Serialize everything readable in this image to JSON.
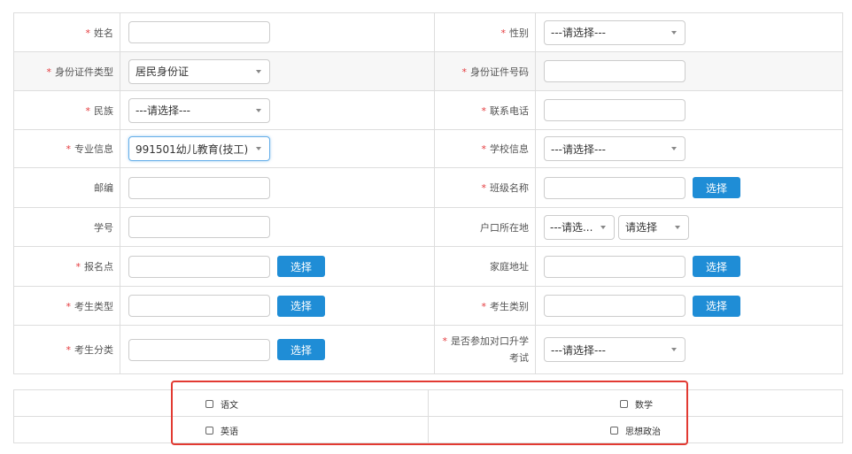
{
  "form": {
    "rows": [
      {
        "left_label": "姓名",
        "left_required": true,
        "left_value": "",
        "right_label": "性别",
        "right_required": true,
        "right_select": "---请选择---"
      },
      {
        "left_label": "身份证件类型",
        "left_required": true,
        "left_select": "居民身份证",
        "right_label": "身份证件号码",
        "right_required": true,
        "right_value": ""
      },
      {
        "left_label": "民族",
        "left_required": true,
        "left_select": "---请选择---",
        "right_label": "联系电话",
        "right_required": true,
        "right_value": ""
      },
      {
        "left_label": "专业信息",
        "left_required": true,
        "left_select": "991501幼儿教育(技工)",
        "right_label": "学校信息",
        "right_required": true,
        "right_select": "---请选择---"
      },
      {
        "left_label": "邮编",
        "left_required": false,
        "left_value": "",
        "right_label": "班级名称",
        "right_required": true,
        "right_value": "",
        "right_button": "选择"
      },
      {
        "left_label": "学号",
        "left_required": false,
        "left_value": "",
        "right_label": "户口所在地",
        "right_required": false,
        "right_select_1": "---请选...",
        "right_select_2": "请选择"
      },
      {
        "left_label": "报名点",
        "left_required": true,
        "left_value": "",
        "left_button": "选择",
        "right_label": "家庭地址",
        "right_required": false,
        "right_value": "",
        "right_button": "选择"
      },
      {
        "left_label": "考生类型",
        "left_required": true,
        "left_value": "",
        "left_button": "选择",
        "right_label": "考生类别",
        "right_required": true,
        "right_value": "",
        "right_button": "选择"
      },
      {
        "left_label": "考生分类",
        "left_required": true,
        "left_value": "",
        "left_button": "选择",
        "right_label": "是否参加对口升学考试",
        "right_required": true,
        "right_select": "---请选择---"
      }
    ]
  },
  "subjects": [
    {
      "label": "语文",
      "checked": false
    },
    {
      "label": "数学",
      "checked": false
    },
    {
      "label": "英语",
      "checked": false
    },
    {
      "label": "思想政治",
      "checked": false
    }
  ],
  "colors": {
    "accent": "#1f8dd6",
    "required": "#e4393c",
    "highlight_box": "#e23a32"
  }
}
